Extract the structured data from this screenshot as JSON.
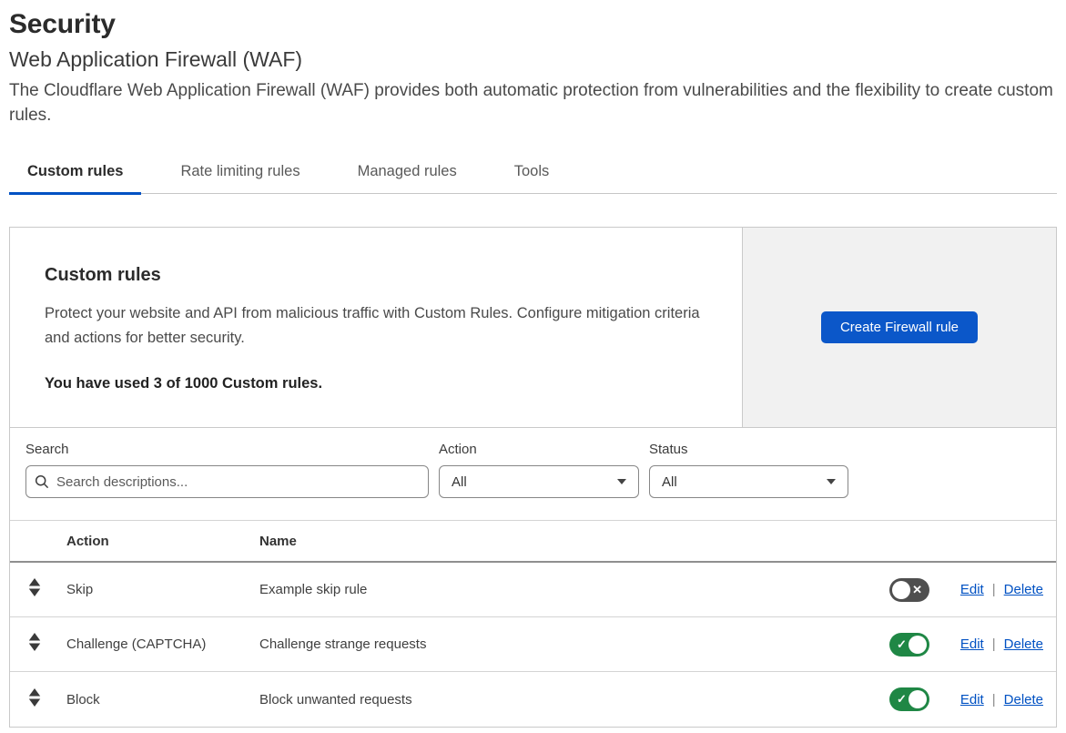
{
  "page": {
    "title": "Security",
    "subtitle": "Web Application Firewall (WAF)",
    "description": "The Cloudflare Web Application Firewall (WAF) provides both automatic protection from vulnerabilities and the flexibility to create custom rules."
  },
  "tabs": [
    {
      "label": "Custom rules",
      "active": true
    },
    {
      "label": "Rate limiting rules",
      "active": false
    },
    {
      "label": "Managed rules",
      "active": false
    },
    {
      "label": "Tools",
      "active": false
    }
  ],
  "card": {
    "heading": "Custom rules",
    "body": "Protect your website and API from malicious traffic with Custom Rules. Configure mitigation criteria and actions for better security.",
    "usage": "You have used 3 of 1000 Custom rules.",
    "cta_label": "Create Firewall rule"
  },
  "filters": {
    "search": {
      "label": "Search",
      "placeholder": "Search descriptions...",
      "value": ""
    },
    "action": {
      "label": "Action",
      "value": "All"
    },
    "status": {
      "label": "Status",
      "value": "All"
    }
  },
  "table": {
    "columns": [
      "Action",
      "Name"
    ],
    "rows": [
      {
        "action": "Skip",
        "name": "Example skip rule",
        "enabled": false
      },
      {
        "action": "Challenge (CAPTCHA)",
        "name": "Challenge strange requests",
        "enabled": true
      },
      {
        "action": "Block",
        "name": "Block unwanted requests",
        "enabled": true
      }
    ]
  },
  "row_actions": {
    "edit": "Edit",
    "separator": "|",
    "delete": "Delete"
  },
  "icons": {
    "search": "magnifier",
    "drag_handle": "reorder-up-down",
    "dropdown": "caret-down",
    "check_glyph": "✓",
    "x_glyph": "✕"
  },
  "colors": {
    "accent_blue": "#0051c3",
    "button_blue": "#0b57c9",
    "toggle_on_green": "#1f8745",
    "toggle_off_gray": "#4f4f4f",
    "cta_panel_gray": "#f1f1f1",
    "card_border": "#c9c9c9"
  }
}
